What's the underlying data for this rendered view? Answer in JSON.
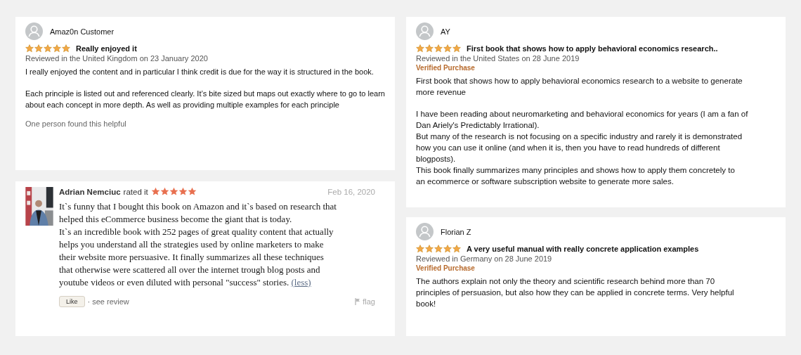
{
  "columns": [
    {
      "reviews": [
        {
          "kind": "amazon",
          "author": "Amaz0n Customer",
          "stars": 5,
          "title": "Really enjoyed it",
          "meta": "Reviewed in the United Kingdom on 23 January 2020",
          "paragraphs": [
            "I really enjoyed the content and in particular I think credit is due for the way it is structured in the book.",
            "Each principle is listed out and referenced clearly. It’s bite sized but maps out exactly where to go to learn\nabout each concept in more depth. As well as providing multiple examples for each principle"
          ],
          "helpful": "One person found this helpful"
        },
        {
          "kind": "goodreads",
          "author": "Adrian Nemciuc",
          "rated": "rated it",
          "stars": 5,
          "date": "Feb 16, 2020",
          "paragraphs": [
            "It`s funny that I bought this book on Amazon and it`s based on research that\nhelped this eCommerce business become the giant that is today.\nIt`s an incredible book with 252 pages of great quality content that actually\nhelps you understand all the strategies used by online marketers to make\ntheir website more persuasive. It finally summarizes all these techniques\nthat otherwise were scattered all over the internet trough blog posts and\nyoutube videos or even diluted with personal \"success\" stories."
          ],
          "less_link": "(less)",
          "like_button": "Like",
          "see_review": "· see review",
          "flag": "flag"
        }
      ]
    },
    {
      "reviews": [
        {
          "kind": "amazon",
          "author": "AY",
          "stars": 5,
          "title": "First book that shows how to apply behavioral economics research..",
          "meta": "Reviewed in the United States on 28 June 2019",
          "verified": "Verified Purchase",
          "paragraphs": [
            "First book that shows how to apply behavioral economics research to a website to generate\nmore revenue",
            "I have been reading about neuromarketing and behavioral economics for years (I am a fan of\nDan Ariely's Predictably Irrational).\nBut many of the research is not focusing on a specific industry and rarely it is demonstrated\nhow you can use it online (and when it is, then you have to read hundreds of different\nblogposts).\nThis book finally summarizes many principles and shows how to apply them concretely to\nan ecommerce or software subscription website to generate more sales."
          ]
        },
        {
          "kind": "amazon",
          "author": "Florian Z",
          "stars": 5,
          "title": "A very useful manual with really concrete application examples",
          "meta": "Reviewed in Germany on 28 June 2019",
          "verified": "Verified Purchase",
          "paragraphs": [
            "The authors explain not only the theory and scientific research behind more than 70\nprinciples of persuasion, but also how they can be applied in concrete terms. Very helpful\nbook!"
          ]
        }
      ]
    }
  ]
}
